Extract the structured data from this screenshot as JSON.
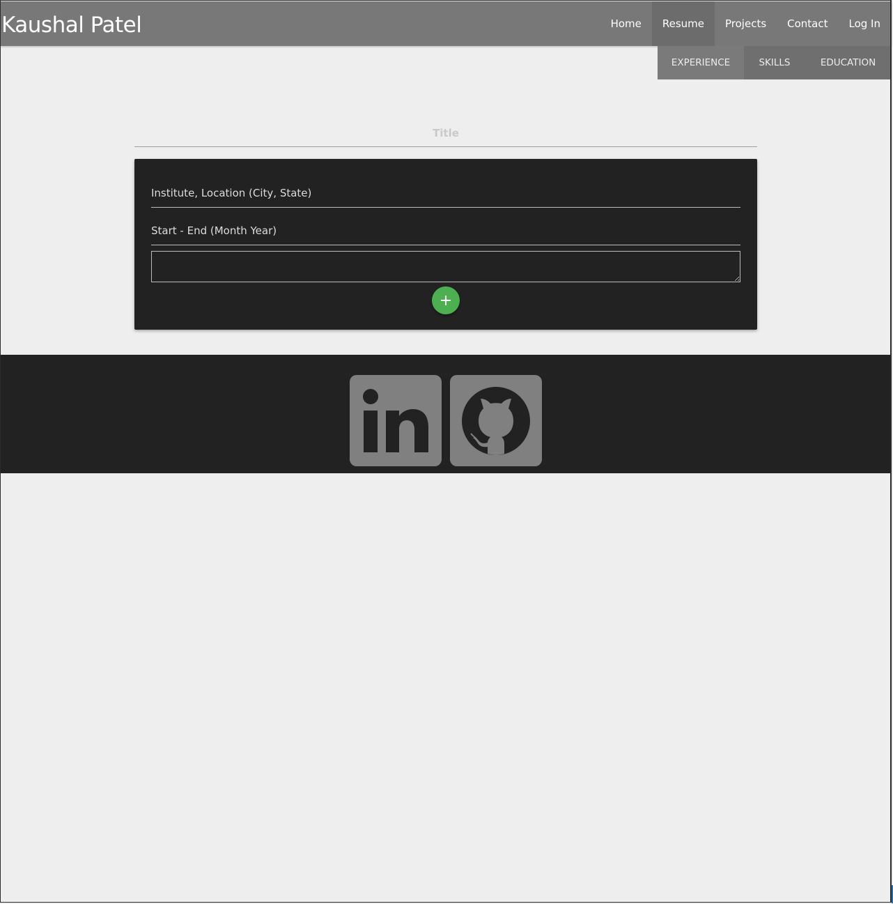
{
  "header": {
    "brand": "Kaushal Patel",
    "nav": [
      {
        "label": "Home",
        "active": false
      },
      {
        "label": "Resume",
        "active": true
      },
      {
        "label": "Projects",
        "active": false
      },
      {
        "label": "Contact",
        "active": false
      },
      {
        "label": "Log In",
        "active": false
      }
    ]
  },
  "subnav": [
    {
      "label": "EXPERIENCE",
      "active": true
    },
    {
      "label": "SKILLS",
      "active": false
    },
    {
      "label": "EDUCATION",
      "active": false
    }
  ],
  "form": {
    "title_placeholder": "Title",
    "institute_placeholder": "Institute, Location (City, State)",
    "dates_placeholder": "Start - End (Month Year)",
    "description_value": "",
    "add_button_icon": "plus-icon"
  },
  "footer": {
    "links": [
      {
        "icon": "linkedin-icon"
      },
      {
        "icon": "github-icon"
      }
    ]
  },
  "colors": {
    "header_bg": "#787878",
    "card_bg": "#222222",
    "footer_bg": "#222222",
    "accent_green": "#4caf50",
    "icon_gray": "#808080"
  }
}
